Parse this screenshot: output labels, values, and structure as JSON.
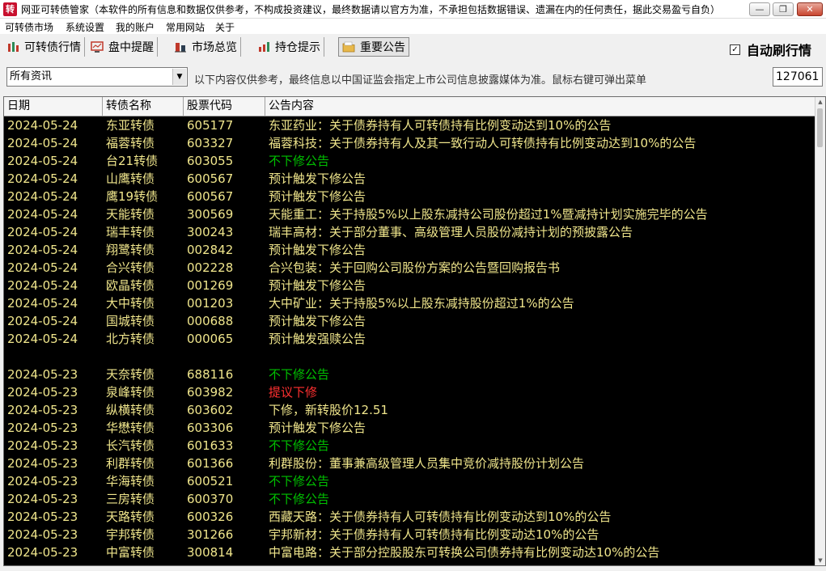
{
  "window": {
    "icon_glyph": "转",
    "title": "网亚可转债管家（本软件的所有信息和数据仅供参考，不构成投资建议，最终数据请以官方为准，不承担包括数据错误、遗漏在内的任何责任，据此交易盈亏自负）",
    "minimize": "—",
    "maximize": "❐",
    "close": "✕"
  },
  "menu": [
    "可转债市场",
    "系统设置",
    "我的账户",
    "常用网站",
    "关于"
  ],
  "tabs": [
    {
      "label": "可转债行情",
      "icon": "market-bars-icon"
    },
    {
      "label": "盘中提醒",
      "icon": "monitor-icon"
    },
    {
      "label": "市场总览",
      "icon": "overview-chart-icon"
    },
    {
      "label": "持仓提示",
      "icon": "position-chart-icon"
    },
    {
      "label": "重要公告",
      "icon": "folder-icon",
      "active": true
    }
  ],
  "auto_refresh": {
    "label": "自动刷行情",
    "checked": "✓"
  },
  "filter": {
    "selected": "所有资讯",
    "arrow": "▼",
    "notice": "以下内容仅供参考，最终信息以中国证监会指定上市公司信息披露媒体为准。鼠标右键可弹出菜单",
    "code_value": "127061"
  },
  "table": {
    "headers": [
      "日期",
      "转债名称",
      "股票代码",
      "公告内容"
    ],
    "rows": [
      {
        "date": "2024-05-24",
        "name": "东亚转债",
        "code": "605177",
        "content": "东亚药业：关于债券持有人可转债持有比例变动达到10%的公告",
        "color": "#f0e68c"
      },
      {
        "date": "2024-05-24",
        "name": "福蓉转债",
        "code": "603327",
        "content": "福蓉科技：关于债券持有人及其一致行动人可转债持有比例变动达到10%的公告",
        "color": "#f0e68c"
      },
      {
        "date": "2024-05-24",
        "name": "台21转债",
        "code": "603055",
        "content": "不下修公告",
        "color": "#00c000"
      },
      {
        "date": "2024-05-24",
        "name": "山鹰转债",
        "code": "600567",
        "content": "预计触发下修公告",
        "color": "#f0e68c"
      },
      {
        "date": "2024-05-24",
        "name": "鹰19转债",
        "code": "600567",
        "content": "预计触发下修公告",
        "color": "#f0e68c"
      },
      {
        "date": "2024-05-24",
        "name": "天能转债",
        "code": "300569",
        "content": "天能重工：关于持股5%以上股东减持公司股份超过1%暨减持计划实施完毕的公告",
        "color": "#f0e68c"
      },
      {
        "date": "2024-05-24",
        "name": "瑞丰转债",
        "code": "300243",
        "content": "瑞丰高材：关于部分董事、高级管理人员股份减持计划的预披露公告",
        "color": "#f0e68c"
      },
      {
        "date": "2024-05-24",
        "name": "翔鹭转债",
        "code": "002842",
        "content": "预计触发下修公告",
        "color": "#f0e68c"
      },
      {
        "date": "2024-05-24",
        "name": "合兴转债",
        "code": "002228",
        "content": "合兴包装：关于回购公司股份方案的公告暨回购报告书",
        "color": "#f0e68c"
      },
      {
        "date": "2024-05-24",
        "name": "欧晶转债",
        "code": "001269",
        "content": "预计触发下修公告",
        "color": "#f0e68c"
      },
      {
        "date": "2024-05-24",
        "name": "大中转债",
        "code": "001203",
        "content": "大中矿业：关于持股5%以上股东减持股份超过1%的公告",
        "color": "#f0e68c"
      },
      {
        "date": "2024-05-24",
        "name": "国城转债",
        "code": "000688",
        "content": "预计触发下修公告",
        "color": "#f0e68c"
      },
      {
        "date": "2024-05-24",
        "name": "北方转债",
        "code": "000065",
        "content": "预计触发强赎公告",
        "color": "#f0e68c"
      },
      {
        "date": "",
        "name": "",
        "code": "",
        "content": "",
        "color": "#f0e68c"
      },
      {
        "date": "2024-05-23",
        "name": "天奈转债",
        "code": "688116",
        "content": "不下修公告",
        "color": "#00c000"
      },
      {
        "date": "2024-05-23",
        "name": "泉峰转债",
        "code": "603982",
        "content": "提议下修",
        "color": "#ff3030"
      },
      {
        "date": "2024-05-23",
        "name": "纵横转债",
        "code": "603602",
        "content": "下修，新转股价12.51",
        "color": "#f0e68c"
      },
      {
        "date": "2024-05-23",
        "name": "华懋转债",
        "code": "603306",
        "content": "预计触发下修公告",
        "color": "#f0e68c"
      },
      {
        "date": "2024-05-23",
        "name": "长汽转债",
        "code": "601633",
        "content": "不下修公告",
        "color": "#00c000"
      },
      {
        "date": "2024-05-23",
        "name": "利群转债",
        "code": "601366",
        "content": "利群股份：董事兼高级管理人员集中竞价减持股份计划公告",
        "color": "#f0e68c"
      },
      {
        "date": "2024-05-23",
        "name": "华海转债",
        "code": "600521",
        "content": "不下修公告",
        "color": "#00c000"
      },
      {
        "date": "2024-05-23",
        "name": "三房转债",
        "code": "600370",
        "content": "不下修公告",
        "color": "#00c000"
      },
      {
        "date": "2024-05-23",
        "name": "天路转债",
        "code": "600326",
        "content": "西藏天路：关于债券持有人可转债持有比例变动达到10%的公告",
        "color": "#f0e68c"
      },
      {
        "date": "2024-05-23",
        "name": "宇邦转债",
        "code": "301266",
        "content": "宇邦新材：关于债券持有人可转债持有比例变动达10%的公告",
        "color": "#f0e68c"
      },
      {
        "date": "2024-05-23",
        "name": "中富转债",
        "code": "300814",
        "content": "中富电路：关于部分控股股东可转换公司债券持有比例变动达10%的公告",
        "color": "#f0e68c"
      }
    ]
  },
  "scrollbar": {
    "up": "▲",
    "down": "▼"
  }
}
